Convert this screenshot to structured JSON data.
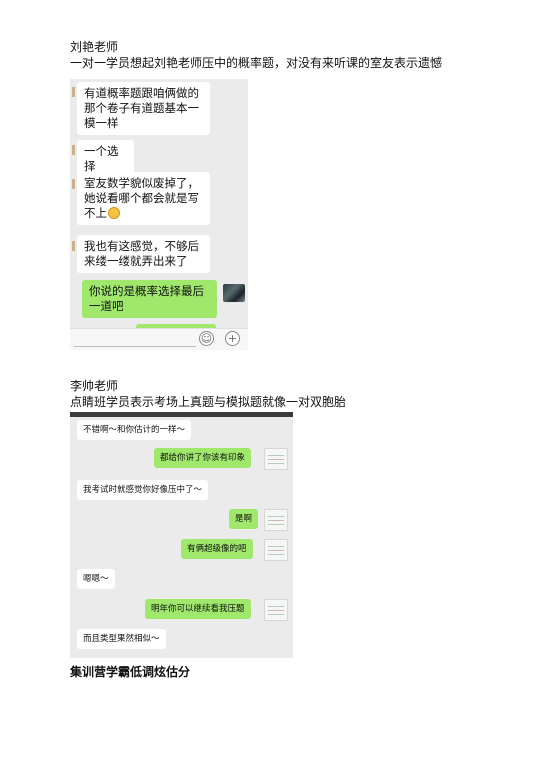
{
  "section1": {
    "teacher": "刘艳老师",
    "caption": "一对一学员想起刘艳老师压中的概率题，对没有来听课的室友表示遗憾",
    "messages": [
      {
        "side": "left",
        "lines": [
          "有道概率题跟咱俩做的",
          "那个卷子有道题基本一",
          "模一样"
        ]
      },
      {
        "side": "left",
        "lines": [
          "一个选择"
        ]
      },
      {
        "side": "left",
        "lines": [
          "室友数学貌似废掉了，",
          "她说看哪个都会就是写",
          "不上"
        ],
        "emoji": "smile-emoji"
      },
      {
        "side": "left",
        "lines": [
          "我也有这感觉，不够后",
          "来缕一缕就弄出来了"
        ]
      },
      {
        "side": "right",
        "lines": [
          "你说的是概率选择最后",
          "一道吧"
        ]
      }
    ],
    "input_add_symbol": "+",
    "input_emoji_symbol": "☺"
  },
  "section2": {
    "teacher": "李帅老师",
    "caption": "点睛班学员表示考场上真题与模拟题就像一对双胞胎",
    "messages": [
      {
        "side": "left",
        "text": "不错啊～和你估计的一样～"
      },
      {
        "side": "right",
        "text": "都给你讲了你该有印象"
      },
      {
        "side": "left",
        "text": "我考试时就感觉你好像压中了～"
      },
      {
        "side": "right",
        "text": "是啊"
      },
      {
        "side": "right",
        "text": "有俩超级像的吧"
      },
      {
        "side": "left",
        "text": "嗯嗯～"
      },
      {
        "side": "right",
        "text": "明年你可以继续看我压题"
      },
      {
        "side": "left",
        "text": "而且类型果然相似～"
      }
    ]
  },
  "section3": {
    "caption": "集训营学霸低调炫估分"
  }
}
